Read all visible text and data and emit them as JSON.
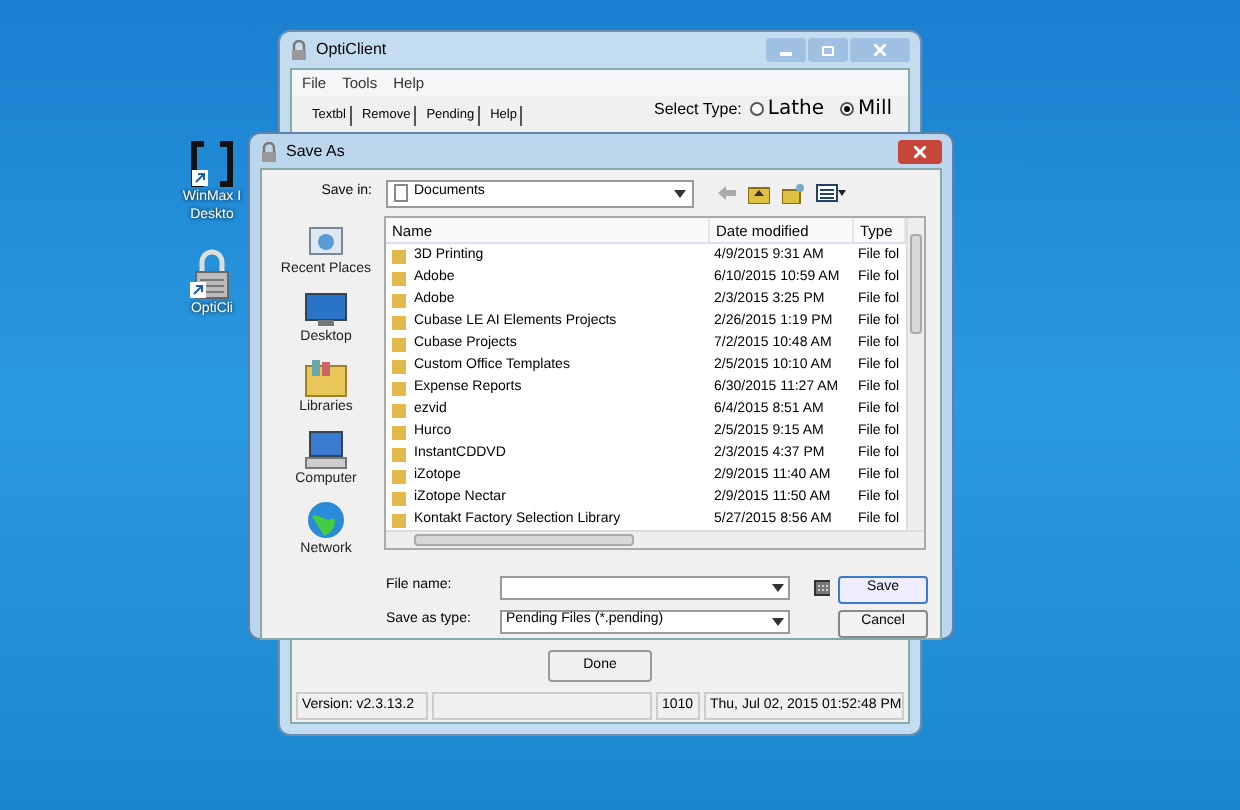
{
  "desktop_icons": [
    {
      "kind": "app",
      "label": [
        "WinMax I",
        "Deskto"
      ]
    },
    {
      "kind": "lock",
      "label": [
        "OptiCli"
      ]
    }
  ],
  "main_window": {
    "title": "OptiClient",
    "menu": [
      "File",
      "Tools",
      "Help"
    ],
    "tabs": [
      "Textbl",
      "Remove",
      "Pending",
      "Help"
    ],
    "select_type_label": "Select Type:",
    "radios": [
      {
        "label": "Lathe",
        "selected": false
      },
      {
        "label": "Mill",
        "selected": true
      }
    ],
    "done_button": "Done",
    "status_bar": [
      "Version: v2.3.13.2",
      "1010",
      "Thu, Jul 02, 2015  01:52:48 PM"
    ]
  },
  "save_dialog": {
    "title": "Save As",
    "save_in_label": "Save in:",
    "save_in_value": "Documents",
    "places": [
      {
        "kind": "recent",
        "label": "Recent Places"
      },
      {
        "kind": "desktop",
        "label": "Desktop"
      },
      {
        "kind": "libraries",
        "label": "Libraries"
      },
      {
        "kind": "computer",
        "label": "Computer"
      },
      {
        "kind": "network",
        "label": "Network"
      }
    ],
    "columns": [
      "Name",
      "Date modified",
      "Type"
    ],
    "files": [
      {
        "name": "3D Printing",
        "date": "4/9/2015 9:31 AM",
        "type": "File fol"
      },
      {
        "name": "Adobe",
        "date": "6/10/2015 10:59 AM",
        "type": "File fol"
      },
      {
        "name": "Adobe",
        "date": "2/3/2015 3:25 PM",
        "type": "File fol"
      },
      {
        "name": "Cubase LE AI Elements Projects",
        "date": "2/26/2015 1:19 PM",
        "type": "File fol"
      },
      {
        "name": "Cubase Projects",
        "date": "7/2/2015 10:48 AM",
        "type": "File fol"
      },
      {
        "name": "Custom Office Templates",
        "date": "2/5/2015 10:10 AM",
        "type": "File fol"
      },
      {
        "name": "Expense Reports",
        "date": "6/30/2015 11:27 AM",
        "type": "File fol"
      },
      {
        "name": "ezvid",
        "date": "6/4/2015 8:51 AM",
        "type": "File fol"
      },
      {
        "name": "Hurco",
        "date": "2/5/2015 9:15 AM",
        "type": "File fol"
      },
      {
        "name": "InstantCDDVD",
        "date": "2/3/2015 4:37 PM",
        "type": "File fol"
      },
      {
        "name": "iZotope",
        "date": "2/9/2015 11:40 AM",
        "type": "File fol"
      },
      {
        "name": "iZotope Nectar",
        "date": "2/9/2015 11:50 AM",
        "type": "File fol"
      },
      {
        "name": "Kontakt Factory Selection Library",
        "date": "5/27/2015 8:56 AM",
        "type": "File fol"
      }
    ],
    "file_name_label": "File name:",
    "save_type_label": "Save as type:",
    "save_type_value": "Pending Files (*.pending)",
    "save_button": "Save",
    "cancel_button": "Cancel"
  }
}
